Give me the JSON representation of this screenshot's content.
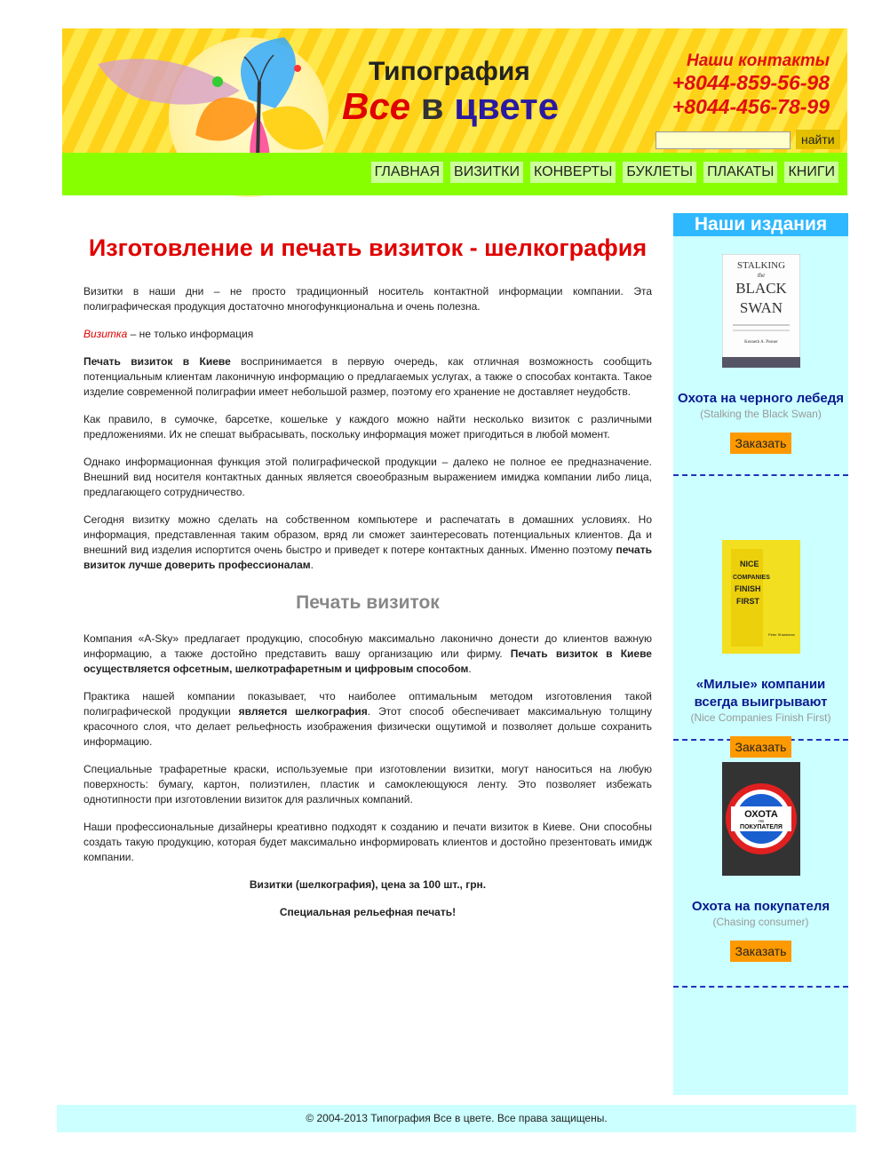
{
  "header": {
    "brand_top": "Типография",
    "brand_word1": "Все",
    "brand_word2": "в",
    "brand_word3": "цвете",
    "contacts_title": "Наши контакты",
    "phone1": "+8044-859-56-98",
    "phone2": "+8044-456-78-99",
    "search_button": "найти",
    "search_value": ""
  },
  "nav": [
    "ГЛАВНАЯ",
    "ВИЗИТКИ",
    "КОНВЕРТЫ",
    "БУКЛЕТЫ",
    "ПЛАКАТЫ",
    "КНИГИ"
  ],
  "main": {
    "title": "Изготовление и печать визиток - шелкография",
    "p1": "Визитки в наши дни – не просто традиционный носитель контактной информации компании. Эта полиграфическая продукция достаточно многофункциональна и очень полезна.",
    "p2_red": "Визитка",
    "p2_rest": " – не только информация",
    "p3_bold": "Печать визиток в Киеве",
    "p3_rest": " воспринимается в первую очередь, как отличная возможность сообщить потенциальным клиентам лаконичную информацию о предлагаемых услугах, а также о способах контакта. Такое изделие современной полиграфии имеет небольшой размер, поэтому его хранение не доставляет неудобств.",
    "p4": "Как правило, в сумочке, барсетке, кошельке у каждого можно найти несколько визиток с различными предложениями. Их не спешат выбрасывать, поскольку информация может пригодиться в любой момент.",
    "p5": "Однако информационная функция этой полиграфической продукции – далеко не полное ее предназначение. Внешний вид носителя контактных данных является своеобразным выражением имиджа компании либо лица, предлагающего сотрудничество.",
    "p6_start": "Сегодня визитку можно сделать на собственном компьютере и распечатать в домашних условиях. Но информация, представленная таким образом, вряд ли сможет заинтересовать потенциальных клиентов. Да и внешний вид изделия испортится очень быстро и приведет к потере контактных данных. Именно поэтому ",
    "p6_bold": "печать визиток лучше доверить профессионалам",
    "p6_end": ".",
    "subtitle": "Печать визиток",
    "p7_start": "Компания «A-Sky» предлагает продукцию, способную максимально лаконично донести до клиентов важную информацию, а также достойно представить вашу организацию или фирму. ",
    "p7_bold": "Печать визиток в Киеве осуществляется офсетным, шелкотрафаретным и цифровым способом",
    "p7_end": ".",
    "p8_start": "Практика нашей компании показывает, что наиболее оптимальным методом изготовления такой полиграфической продукции ",
    "p8_bold": "является шелкография",
    "p8_end": ". Этот способ обеспечивает максимальную толщину красочного слоя, что делает рельефность изображения физически ощутимой и позволяет дольше сохранить информацию.",
    "p9": "Специальные трафаретные краски, используемые при изготовлении визитки, могут наноситься на любую поверхность: бумагу, картон, полиэтилен, пластик и самоклеющуюся ленту. Это позволяет избежать однотипности при изготовлении визиток для различных компаний.",
    "p10": "Наши профессиональные дизайнеры креативно подходят к созданию и печати визиток в Киеве. Они способны создать такую продукцию, которая будет максимально информировать клиентов и достойно презентовать имидж компании.",
    "price_line": "Визитки (шелкография), цена за 100 шт., грн.",
    "special_line": "Специальная рельефная печать!"
  },
  "sidebar": {
    "heading": "Наши издания",
    "order_label": "Заказать",
    "books": [
      {
        "title": "Охота на черного лебедя",
        "subtitle": "(Stalking the Black Swan)",
        "cover_text": [
          "STALKING",
          "the",
          "BLACK",
          "SWAN"
        ],
        "cover_author": "Kenneth A. Posner"
      },
      {
        "title": "«Милые» компании всегда выигрывают",
        "subtitle": "(Nice Companies Finish First)",
        "cover_text": [
          "NICE",
          "COMPANIES",
          "FINISH",
          "FIRST"
        ],
        "cover_author": "Peter Shankman"
      },
      {
        "title": "Охота на покупателя",
        "subtitle": "(Chasing consumer)",
        "cover_text": [
          "ОХОТА",
          "на",
          "ПОКУПАТЕЛЯ"
        ],
        "cover_author": ""
      }
    ]
  },
  "footer": {
    "text": "© 2004-2013 Типография Все в цвете. Все права защищены."
  }
}
